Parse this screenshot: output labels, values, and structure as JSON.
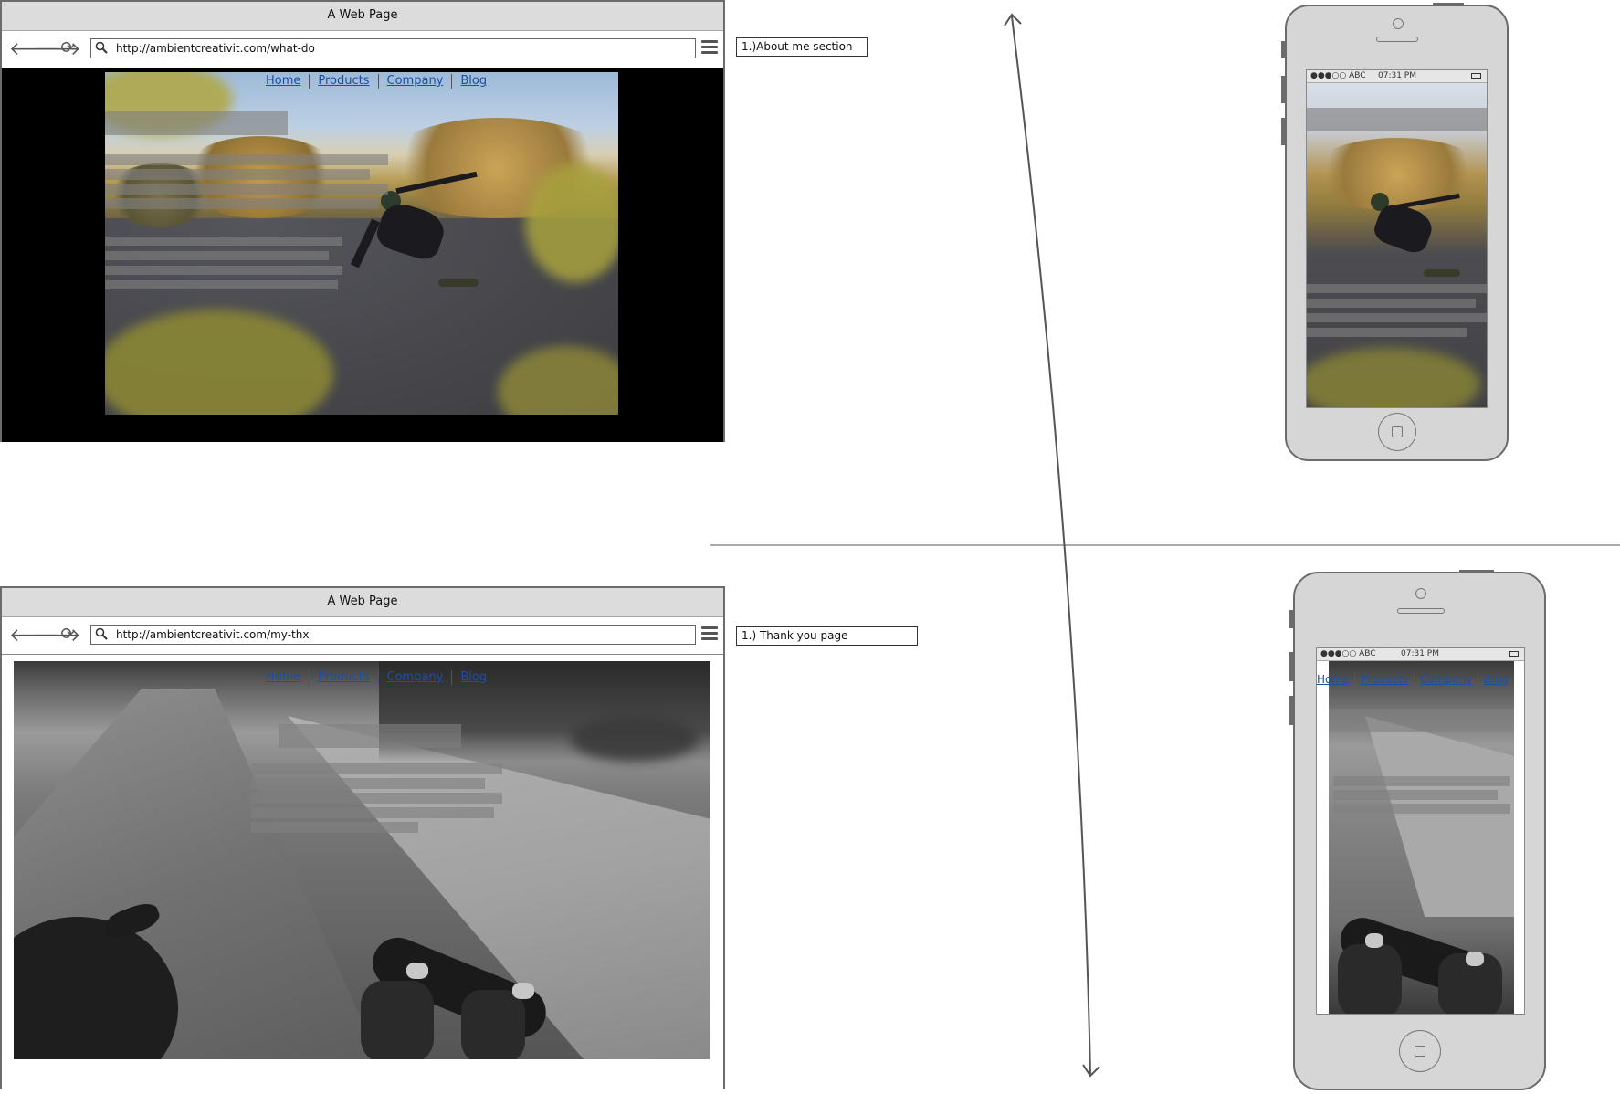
{
  "browser_top": {
    "title": "A Web Page",
    "url": "http://ambientcreativit.com/what-do",
    "nav": [
      "Home",
      "Products",
      "Company",
      "Blog"
    ]
  },
  "browser_bottom": {
    "title": "A Web Page",
    "url": "http://ambientcreativit.com/my-thx",
    "nav": [
      "Home",
      "Products",
      "Company",
      "Blog"
    ]
  },
  "notes": {
    "top": "1.)About me section",
    "bottom": "1.) Thank you page"
  },
  "phone_top": {
    "signal": "●●●○○ ABC",
    "time": "07:31 PM"
  },
  "phone_bottom": {
    "signal": "●●●○○ ABC",
    "time": "07:31 PM",
    "nav": [
      "Home",
      "Products",
      "Company",
      "Blog"
    ]
  },
  "icons": {
    "back": "arrow-left-icon",
    "forward": "arrow-right-icon",
    "reload": "reload-icon",
    "search": "search-icon",
    "menu": "hamburger-menu-icon"
  }
}
